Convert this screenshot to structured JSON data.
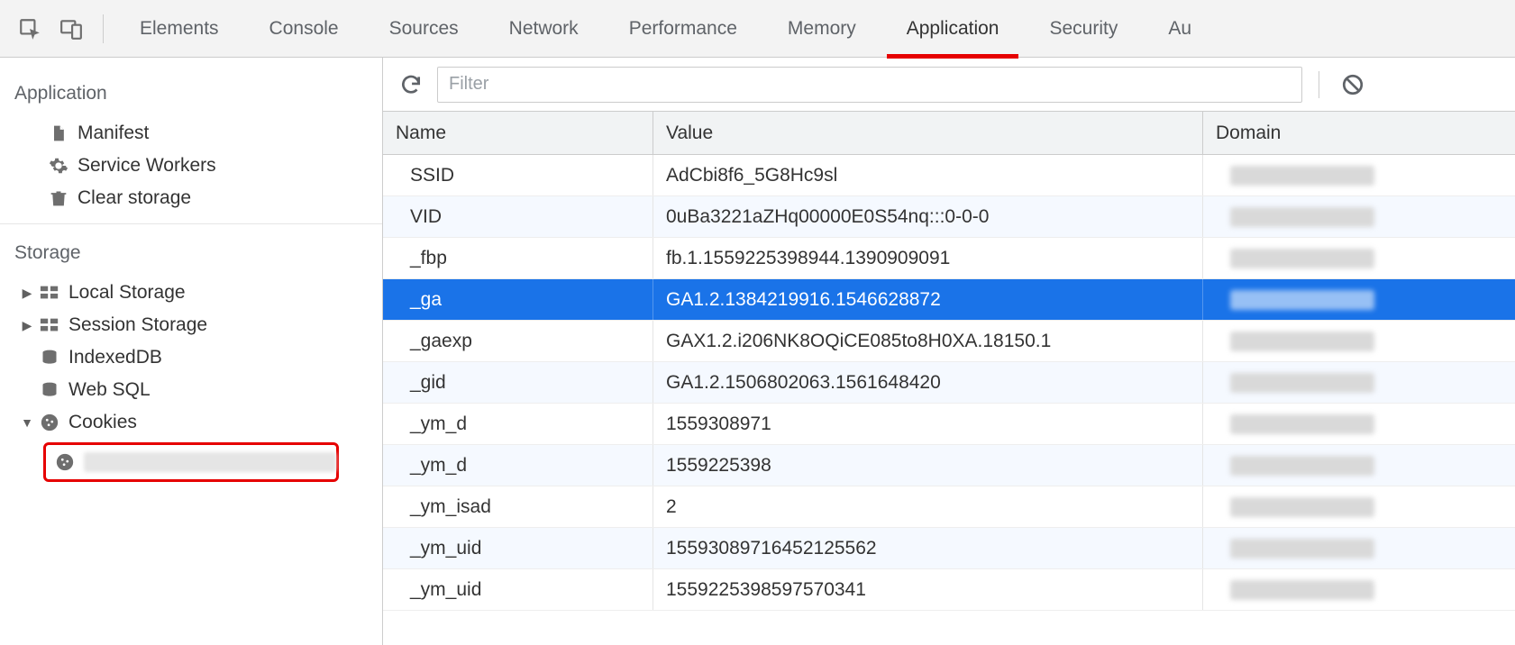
{
  "tabs": [
    "Elements",
    "Console",
    "Sources",
    "Network",
    "Performance",
    "Memory",
    "Application",
    "Security",
    "Au"
  ],
  "active_tab_index": 6,
  "sidebar": {
    "section1": "Application",
    "items1": [
      {
        "label": "Manifest",
        "icon": "file"
      },
      {
        "label": "Service Workers",
        "icon": "gear"
      },
      {
        "label": "Clear storage",
        "icon": "trash"
      }
    ],
    "section2": "Storage",
    "items2": [
      {
        "label": "Local Storage",
        "icon": "storage",
        "exp": true
      },
      {
        "label": "Session Storage",
        "icon": "storage",
        "exp": true
      },
      {
        "label": "IndexedDB",
        "icon": "db",
        "exp": false
      },
      {
        "label": "Web SQL",
        "icon": "db",
        "exp": false
      },
      {
        "label": "Cookies",
        "icon": "cookie",
        "exp": true,
        "open": true
      }
    ]
  },
  "toolbar": {
    "filter_placeholder": "Filter"
  },
  "columns": {
    "name": "Name",
    "value": "Value",
    "domain": "Domain"
  },
  "rows": [
    {
      "name": "SSID",
      "value": "AdCbi8f6_5G8Hc9sl"
    },
    {
      "name": "VID",
      "value": "0uBa3221aZHq00000E0S54nq:::0-0-0"
    },
    {
      "name": "_fbp",
      "value": "fb.1.1559225398944.1390909091"
    },
    {
      "name": "_ga",
      "value": "GA1.2.1384219916.1546628872"
    },
    {
      "name": "_gaexp",
      "value": "GAX1.2.i206NK8OQiCE085to8H0XA.18150.1"
    },
    {
      "name": "_gid",
      "value": "GA1.2.1506802063.1561648420"
    },
    {
      "name": "_ym_d",
      "value": "1559308971"
    },
    {
      "name": "_ym_d",
      "value": "1559225398"
    },
    {
      "name": "_ym_isad",
      "value": "2"
    },
    {
      "name": "_ym_uid",
      "value": "15593089716452125562"
    },
    {
      "name": "_ym_uid",
      "value": "1559225398597570341"
    }
  ],
  "selected_row_index": 3
}
